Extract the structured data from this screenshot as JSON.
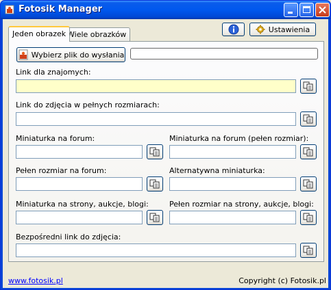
{
  "window": {
    "title": "Fotosik Manager"
  },
  "tabs": [
    {
      "label": "Jeden obrazek",
      "active": true
    },
    {
      "label": "Wiele obrazków",
      "active": false
    }
  ],
  "toolbar": {
    "info_icon": "info-icon",
    "settings_label": "Ustawienia"
  },
  "upload": {
    "choose_label": "Wybierz plik do wysłania",
    "progress": 0
  },
  "fields": {
    "link_friends": {
      "label": "Link dla znajomych:",
      "value": ""
    },
    "link_full": {
      "label": "Link do zdjęcia w pełnych rozmiarach:",
      "value": ""
    },
    "thumb_forum": {
      "label": "Miniaturka na forum:",
      "value": ""
    },
    "thumb_forum_full": {
      "label": "Miniaturka na forum (pełen rozmiar):",
      "value": ""
    },
    "full_forum": {
      "label": "Pełen rozmiar na forum:",
      "value": ""
    },
    "alt_thumb": {
      "label": "Alternatywna miniaturka:",
      "value": ""
    },
    "thumb_pages": {
      "label": "Miniaturka na strony, aukcje, blogi:",
      "value": ""
    },
    "full_pages": {
      "label": "Pełen rozmiar na strony, aukcje, blogi:",
      "value": ""
    },
    "direct": {
      "label": "Bezpośredni link do zdjęcia:",
      "value": ""
    }
  },
  "footer": {
    "link": "www.fotosik.pl",
    "copyright": "Copyright (c) Fotosik.pl"
  },
  "colors": {
    "titlebar": "#0058EE",
    "highlight_field": "#FFFFC9",
    "tab_accent": "#FFC83C"
  }
}
